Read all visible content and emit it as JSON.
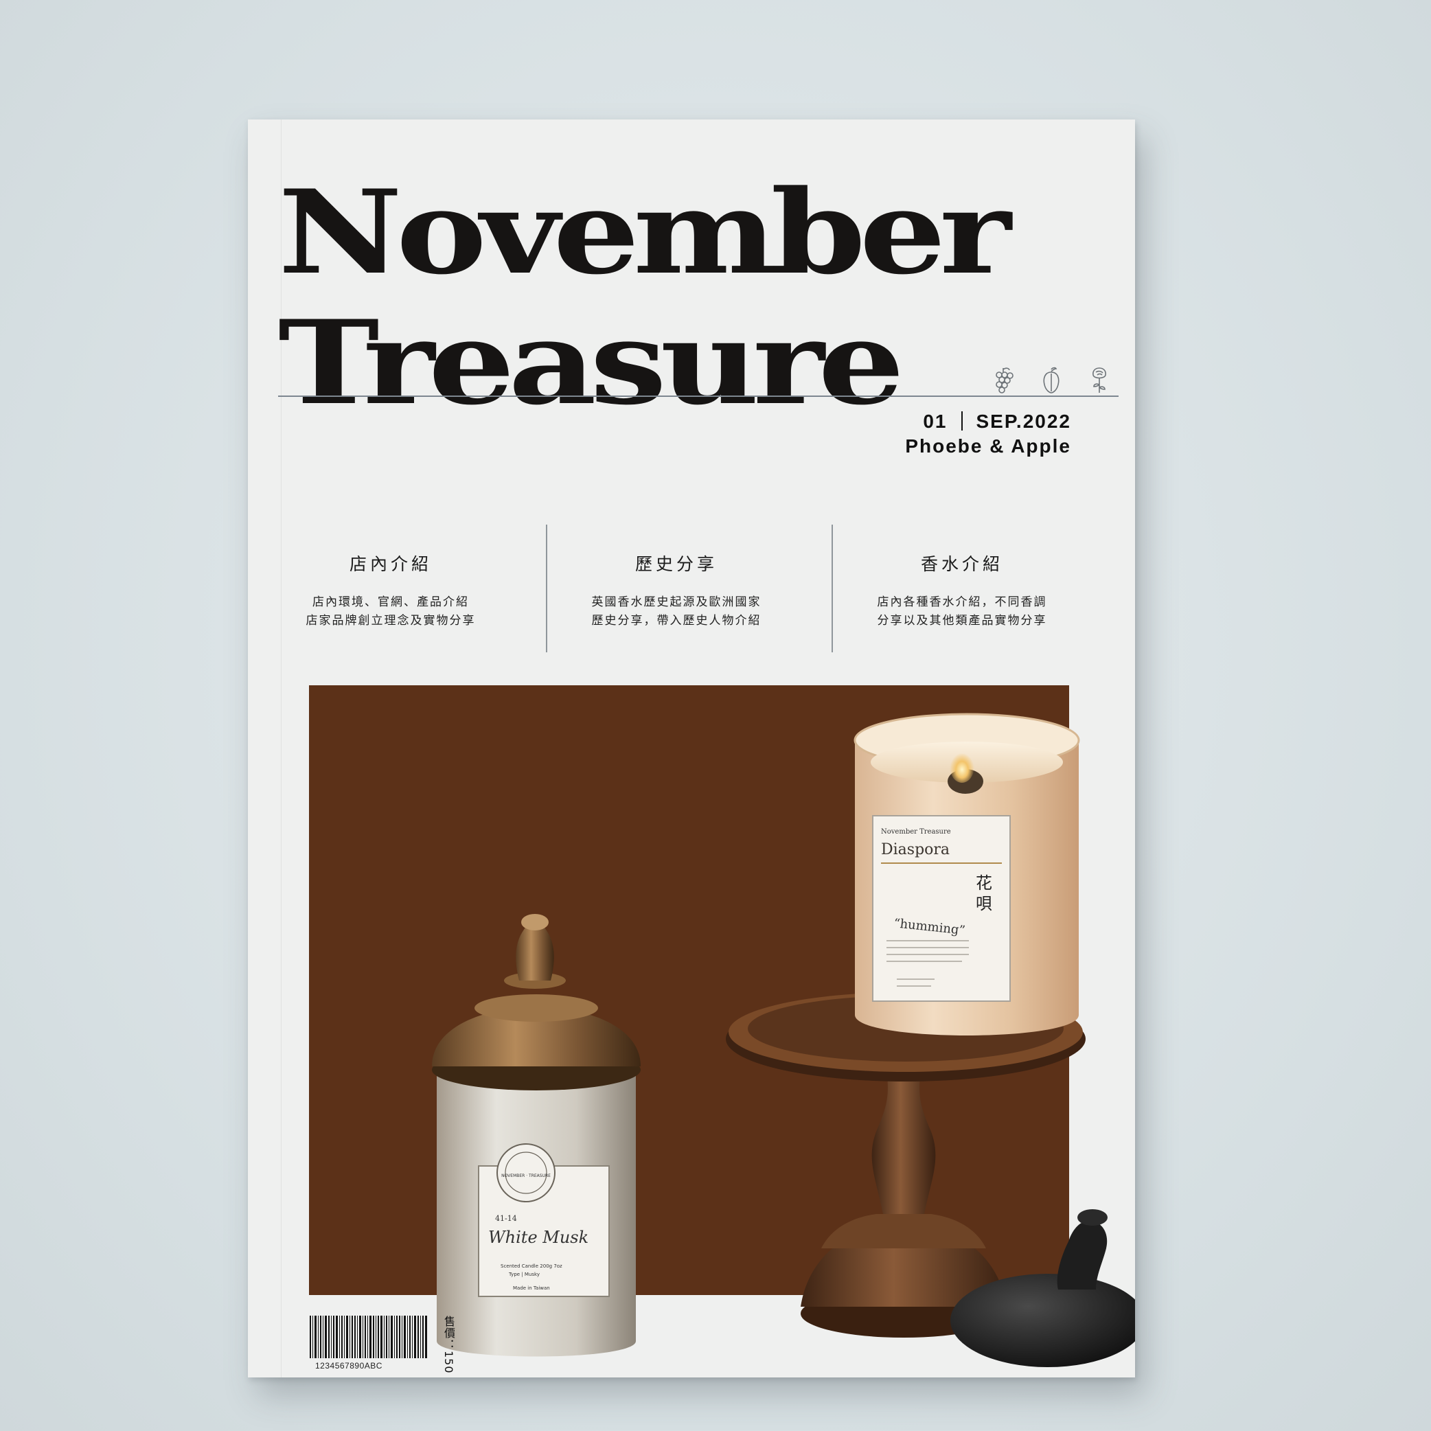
{
  "cover": {
    "title_line1": "November",
    "title_line2": "Treasure",
    "issue_number": "01",
    "issue_date": "SEP.2022",
    "authors": "Phoebe & Apple",
    "icons": [
      "grapes-icon",
      "fruit-icon",
      "rose-icon"
    ]
  },
  "sections": [
    {
      "heading": "店內介紹",
      "line1": "店內環境、官網、產品介紹",
      "line2": "店家品牌創立理念及實物分享"
    },
    {
      "heading": "歷史分享",
      "line1": "英國香水歷史起源及歐洲國家",
      "line2": "歷史分享，帶入歷史人物介紹"
    },
    {
      "heading": "香水介紹",
      "line1": "店內各種香水介紹，不同香調",
      "line2": "分享以及其他類產品實物分享"
    }
  ],
  "photo": {
    "candle_brand": "November Treasure",
    "candle1_name": "Diaspora",
    "candle1_chinese_1": "花",
    "candle1_chinese_2": "唄",
    "candle1_subtitle": "“humming”",
    "candle2_number": "41-14",
    "candle2_name": "White Musk",
    "candle2_spec": "Scented Candle 200g 7oz",
    "candle2_type": "Type | Musky",
    "candle2_origin": "Made in Taiwan",
    "candle2_seal": "NOVEMBER · TREASURE"
  },
  "footer": {
    "barcode_number": "1234567890ABC",
    "price": "售價：150"
  },
  "colors": {
    "cover_bg": "#eff0ef",
    "photo_bg": "#5c3118",
    "title_ink": "#161413"
  }
}
